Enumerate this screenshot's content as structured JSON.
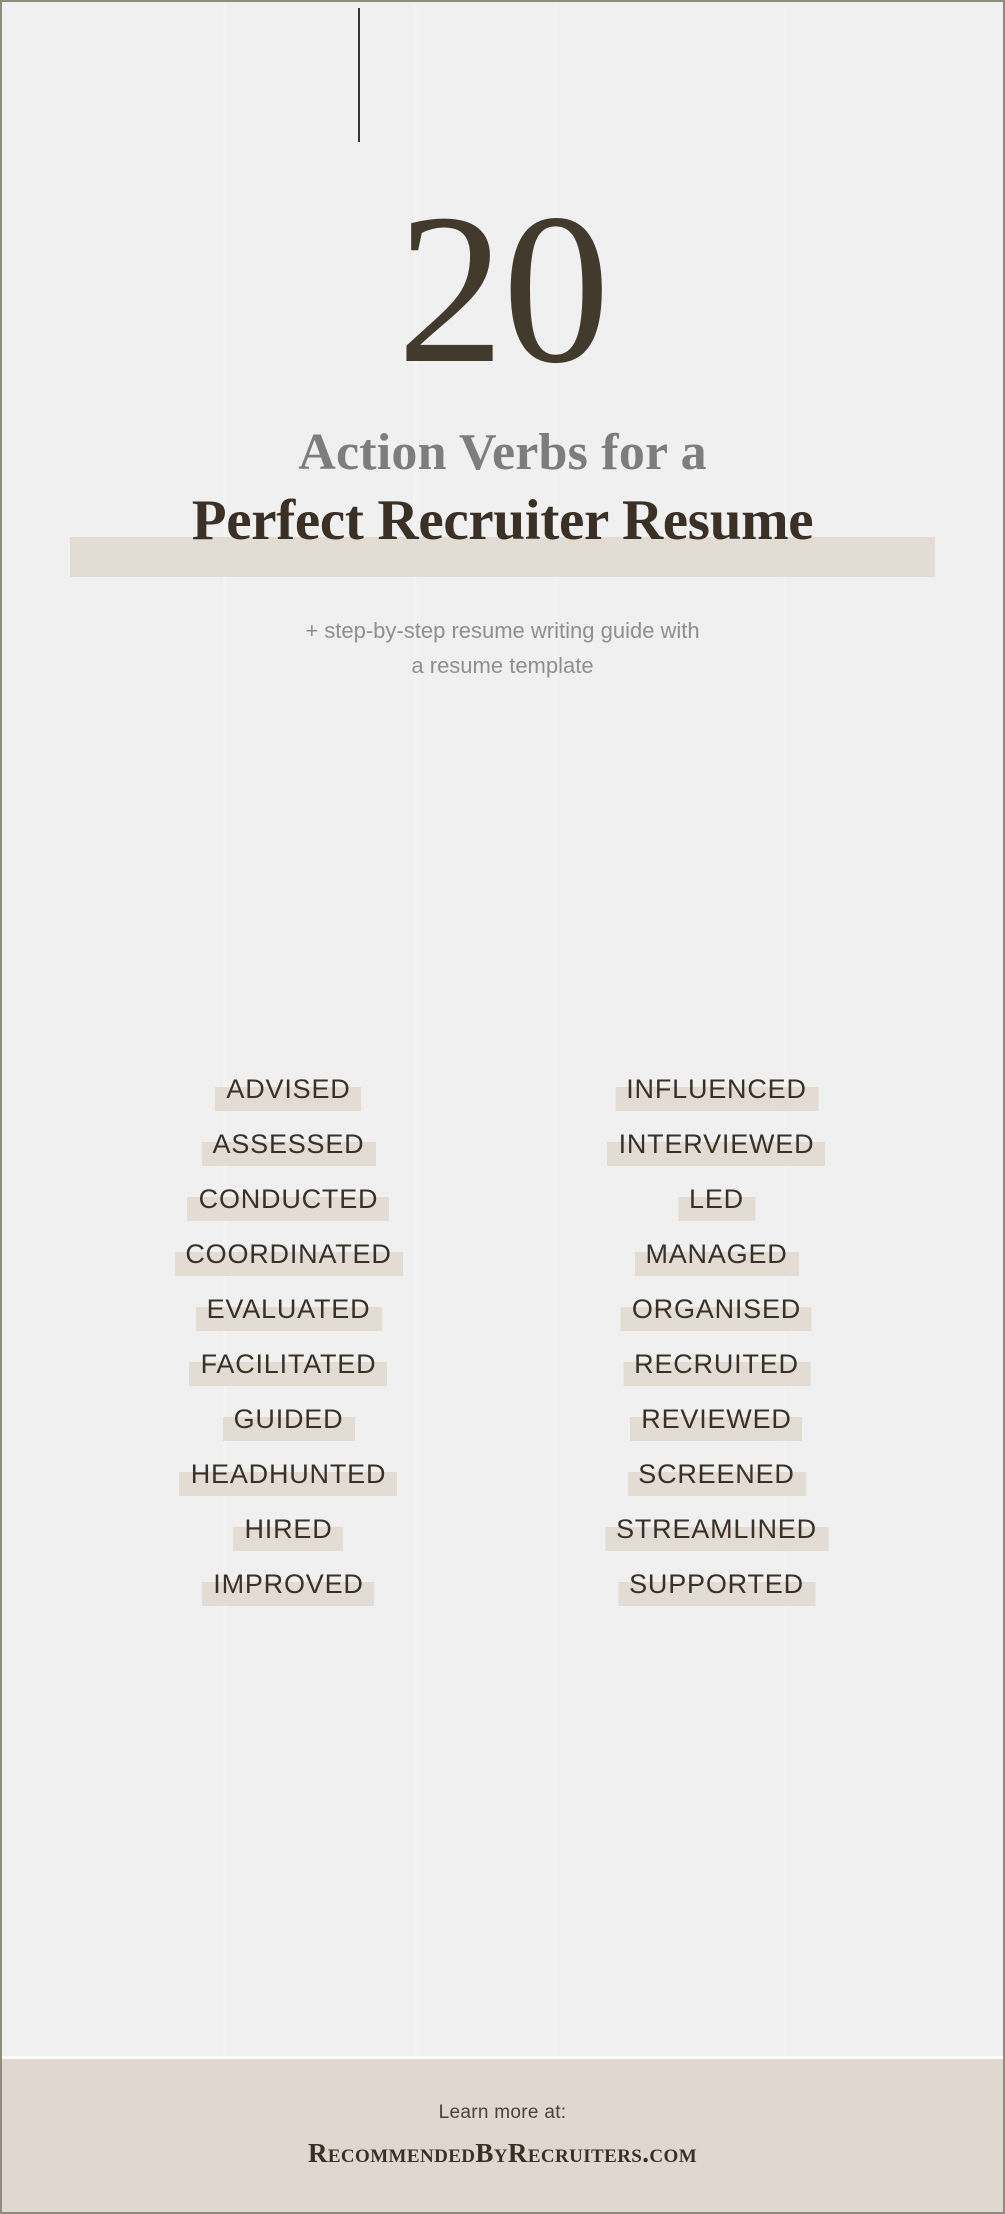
{
  "poster": {
    "background_color": "#eff0ef",
    "border_color": "#8d8d7e",
    "accent_highlight": "#e3dcd4",
    "dark_text": "#3a3026",
    "muted_text": "#8f8f8f"
  },
  "header": {
    "big_number": "20",
    "subtitle_line_1": "Action Verbs for a",
    "headline": "Perfect Recruiter Resume",
    "lede_line_1": "+ step-by-step resume writing guide with",
    "lede_line_2": "a resume template"
  },
  "verbs": {
    "left_column": [
      "ADVISED",
      "ASSESSED",
      "CONDUCTED",
      "COORDINATED",
      "EVALUATED",
      "FACILITATED",
      "GUIDED",
      "HEADHUNTED",
      "HIRED",
      "IMPROVED"
    ],
    "right_column": [
      "INFLUENCED",
      "INTERVIEWED",
      "LED",
      "MANAGED",
      "ORGANISED",
      "RECRUITED",
      "REVIEWED",
      "SCREENED",
      "STREAMLINED",
      "SUPPORTED"
    ]
  },
  "footer": {
    "lead_text": "Learn more at:",
    "brand": "RecommendedByRecruiters.com",
    "background_color": "#e0d8d0"
  }
}
